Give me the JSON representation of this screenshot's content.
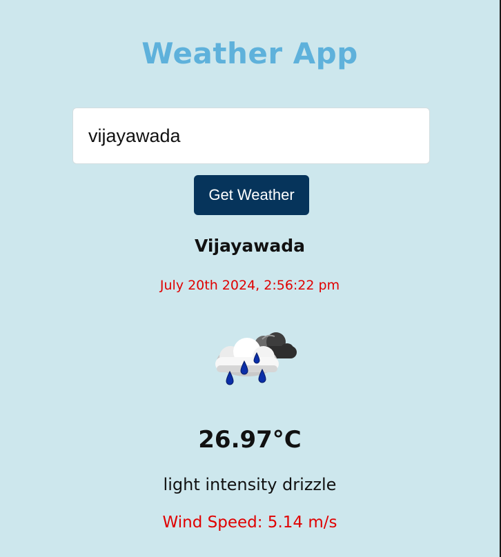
{
  "app": {
    "title": "Weather App"
  },
  "search": {
    "value": "vijayawada",
    "button_label": "Get Weather"
  },
  "weather": {
    "city": "Vijayawada",
    "datetime": "July 20th 2024, 2:56:22 pm",
    "icon": "rain-cloud-icon",
    "temperature": "26.97°C",
    "description": "light intensity drizzle",
    "wind": "Wind Speed: 5.14 m/s"
  },
  "colors": {
    "background": "#cde7ed",
    "title": "#5eb1db",
    "button": "#06345b",
    "accent_red": "#e00000"
  }
}
